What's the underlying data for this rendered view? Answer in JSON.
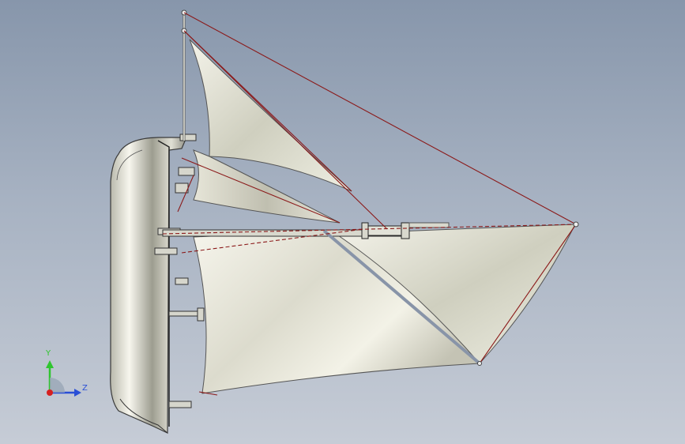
{
  "viewport": {
    "background_top": "#8796ab",
    "background_bottom": "#c6ccd6"
  },
  "model": {
    "sail_color": "#e9e8dc",
    "rigging_color": "#8b1a1a",
    "hull_color": "#c8c8b8"
  },
  "triad": {
    "y_label": "Y",
    "z_label": "Z",
    "y_color": "#2fc52f",
    "z_color": "#2a4fd6",
    "x_color": "#d62020"
  }
}
